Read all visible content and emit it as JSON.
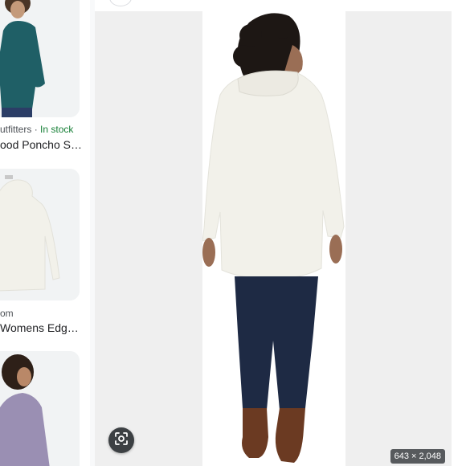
{
  "results": [
    {
      "meta_source": "utfitters",
      "meta_sep": "·",
      "meta_status": "In stock",
      "title": "ood Poncho S…"
    },
    {
      "meta_source": "om",
      "title": "Womens Edg…"
    },
    {}
  ],
  "preview": {
    "dimensions": "643 × 2,048",
    "lens_icon": "lens-search-icon"
  },
  "colors": {
    "in_stock": "#188038",
    "teal_sweater": "#1f5f66",
    "ivory_sweater": "#f2f1ea",
    "lilac_sweater": "#9a8fb3",
    "denim": "#1e2a44",
    "boots": "#6b3a22"
  }
}
